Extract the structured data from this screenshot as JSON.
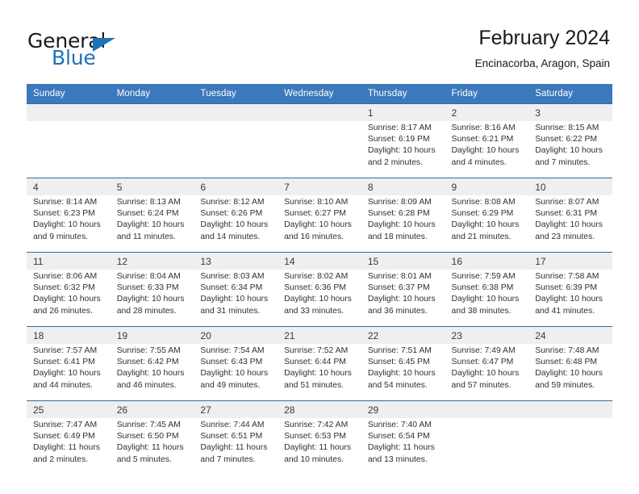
{
  "brand": {
    "name_part1": "General",
    "name_part2": "Blue",
    "accent_color": "#1F72B8"
  },
  "header": {
    "title": "February 2024",
    "subtitle": "Encinacorba, Aragon, Spain"
  },
  "colors": {
    "header_row_bg": "#3B79BC",
    "daynum_bg": "#EFEFEF",
    "separator": "#2B6CAD",
    "text": "#303030"
  },
  "weekday_headers": [
    "Sunday",
    "Monday",
    "Tuesday",
    "Wednesday",
    "Thursday",
    "Friday",
    "Saturday"
  ],
  "weeks": [
    {
      "days": [
        {
          "date": "",
          "blank": true,
          "sunrise": "",
          "sunset": "",
          "daylight_line1": "",
          "daylight_line2": ""
        },
        {
          "date": "",
          "blank": true,
          "sunrise": "",
          "sunset": "",
          "daylight_line1": "",
          "daylight_line2": ""
        },
        {
          "date": "",
          "blank": true,
          "sunrise": "",
          "sunset": "",
          "daylight_line1": "",
          "daylight_line2": ""
        },
        {
          "date": "",
          "blank": true,
          "sunrise": "",
          "sunset": "",
          "daylight_line1": "",
          "daylight_line2": ""
        },
        {
          "date": "1",
          "blank": false,
          "sunrise": "Sunrise: 8:17 AM",
          "sunset": "Sunset: 6:19 PM",
          "daylight_line1": "Daylight: 10 hours",
          "daylight_line2": "and 2 minutes."
        },
        {
          "date": "2",
          "blank": false,
          "sunrise": "Sunrise: 8:16 AM",
          "sunset": "Sunset: 6:21 PM",
          "daylight_line1": "Daylight: 10 hours",
          "daylight_line2": "and 4 minutes."
        },
        {
          "date": "3",
          "blank": false,
          "sunrise": "Sunrise: 8:15 AM",
          "sunset": "Sunset: 6:22 PM",
          "daylight_line1": "Daylight: 10 hours",
          "daylight_line2": "and 7 minutes."
        }
      ]
    },
    {
      "days": [
        {
          "date": "4",
          "blank": false,
          "sunrise": "Sunrise: 8:14 AM",
          "sunset": "Sunset: 6:23 PM",
          "daylight_line1": "Daylight: 10 hours",
          "daylight_line2": "and 9 minutes."
        },
        {
          "date": "5",
          "blank": false,
          "sunrise": "Sunrise: 8:13 AM",
          "sunset": "Sunset: 6:24 PM",
          "daylight_line1": "Daylight: 10 hours",
          "daylight_line2": "and 11 minutes."
        },
        {
          "date": "6",
          "blank": false,
          "sunrise": "Sunrise: 8:12 AM",
          "sunset": "Sunset: 6:26 PM",
          "daylight_line1": "Daylight: 10 hours",
          "daylight_line2": "and 14 minutes."
        },
        {
          "date": "7",
          "blank": false,
          "sunrise": "Sunrise: 8:10 AM",
          "sunset": "Sunset: 6:27 PM",
          "daylight_line1": "Daylight: 10 hours",
          "daylight_line2": "and 16 minutes."
        },
        {
          "date": "8",
          "blank": false,
          "sunrise": "Sunrise: 8:09 AM",
          "sunset": "Sunset: 6:28 PM",
          "daylight_line1": "Daylight: 10 hours",
          "daylight_line2": "and 18 minutes."
        },
        {
          "date": "9",
          "blank": false,
          "sunrise": "Sunrise: 8:08 AM",
          "sunset": "Sunset: 6:29 PM",
          "daylight_line1": "Daylight: 10 hours",
          "daylight_line2": "and 21 minutes."
        },
        {
          "date": "10",
          "blank": false,
          "sunrise": "Sunrise: 8:07 AM",
          "sunset": "Sunset: 6:31 PM",
          "daylight_line1": "Daylight: 10 hours",
          "daylight_line2": "and 23 minutes."
        }
      ]
    },
    {
      "days": [
        {
          "date": "11",
          "blank": false,
          "sunrise": "Sunrise: 8:06 AM",
          "sunset": "Sunset: 6:32 PM",
          "daylight_line1": "Daylight: 10 hours",
          "daylight_line2": "and 26 minutes."
        },
        {
          "date": "12",
          "blank": false,
          "sunrise": "Sunrise: 8:04 AM",
          "sunset": "Sunset: 6:33 PM",
          "daylight_line1": "Daylight: 10 hours",
          "daylight_line2": "and 28 minutes."
        },
        {
          "date": "13",
          "blank": false,
          "sunrise": "Sunrise: 8:03 AM",
          "sunset": "Sunset: 6:34 PM",
          "daylight_line1": "Daylight: 10 hours",
          "daylight_line2": "and 31 minutes."
        },
        {
          "date": "14",
          "blank": false,
          "sunrise": "Sunrise: 8:02 AM",
          "sunset": "Sunset: 6:36 PM",
          "daylight_line1": "Daylight: 10 hours",
          "daylight_line2": "and 33 minutes."
        },
        {
          "date": "15",
          "blank": false,
          "sunrise": "Sunrise: 8:01 AM",
          "sunset": "Sunset: 6:37 PM",
          "daylight_line1": "Daylight: 10 hours",
          "daylight_line2": "and 36 minutes."
        },
        {
          "date": "16",
          "blank": false,
          "sunrise": "Sunrise: 7:59 AM",
          "sunset": "Sunset: 6:38 PM",
          "daylight_line1": "Daylight: 10 hours",
          "daylight_line2": "and 38 minutes."
        },
        {
          "date": "17",
          "blank": false,
          "sunrise": "Sunrise: 7:58 AM",
          "sunset": "Sunset: 6:39 PM",
          "daylight_line1": "Daylight: 10 hours",
          "daylight_line2": "and 41 minutes."
        }
      ]
    },
    {
      "days": [
        {
          "date": "18",
          "blank": false,
          "sunrise": "Sunrise: 7:57 AM",
          "sunset": "Sunset: 6:41 PM",
          "daylight_line1": "Daylight: 10 hours",
          "daylight_line2": "and 44 minutes."
        },
        {
          "date": "19",
          "blank": false,
          "sunrise": "Sunrise: 7:55 AM",
          "sunset": "Sunset: 6:42 PM",
          "daylight_line1": "Daylight: 10 hours",
          "daylight_line2": "and 46 minutes."
        },
        {
          "date": "20",
          "blank": false,
          "sunrise": "Sunrise: 7:54 AM",
          "sunset": "Sunset: 6:43 PM",
          "daylight_line1": "Daylight: 10 hours",
          "daylight_line2": "and 49 minutes."
        },
        {
          "date": "21",
          "blank": false,
          "sunrise": "Sunrise: 7:52 AM",
          "sunset": "Sunset: 6:44 PM",
          "daylight_line1": "Daylight: 10 hours",
          "daylight_line2": "and 51 minutes."
        },
        {
          "date": "22",
          "blank": false,
          "sunrise": "Sunrise: 7:51 AM",
          "sunset": "Sunset: 6:45 PM",
          "daylight_line1": "Daylight: 10 hours",
          "daylight_line2": "and 54 minutes."
        },
        {
          "date": "23",
          "blank": false,
          "sunrise": "Sunrise: 7:49 AM",
          "sunset": "Sunset: 6:47 PM",
          "daylight_line1": "Daylight: 10 hours",
          "daylight_line2": "and 57 minutes."
        },
        {
          "date": "24",
          "blank": false,
          "sunrise": "Sunrise: 7:48 AM",
          "sunset": "Sunset: 6:48 PM",
          "daylight_line1": "Daylight: 10 hours",
          "daylight_line2": "and 59 minutes."
        }
      ]
    },
    {
      "days": [
        {
          "date": "25",
          "blank": false,
          "sunrise": "Sunrise: 7:47 AM",
          "sunset": "Sunset: 6:49 PM",
          "daylight_line1": "Daylight: 11 hours",
          "daylight_line2": "and 2 minutes."
        },
        {
          "date": "26",
          "blank": false,
          "sunrise": "Sunrise: 7:45 AM",
          "sunset": "Sunset: 6:50 PM",
          "daylight_line1": "Daylight: 11 hours",
          "daylight_line2": "and 5 minutes."
        },
        {
          "date": "27",
          "blank": false,
          "sunrise": "Sunrise: 7:44 AM",
          "sunset": "Sunset: 6:51 PM",
          "daylight_line1": "Daylight: 11 hours",
          "daylight_line2": "and 7 minutes."
        },
        {
          "date": "28",
          "blank": false,
          "sunrise": "Sunrise: 7:42 AM",
          "sunset": "Sunset: 6:53 PM",
          "daylight_line1": "Daylight: 11 hours",
          "daylight_line2": "and 10 minutes."
        },
        {
          "date": "29",
          "blank": false,
          "sunrise": "Sunrise: 7:40 AM",
          "sunset": "Sunset: 6:54 PM",
          "daylight_line1": "Daylight: 11 hours",
          "daylight_line2": "and 13 minutes."
        },
        {
          "date": "",
          "blank": true,
          "sunrise": "",
          "sunset": "",
          "daylight_line1": "",
          "daylight_line2": ""
        },
        {
          "date": "",
          "blank": true,
          "sunrise": "",
          "sunset": "",
          "daylight_line1": "",
          "daylight_line2": ""
        }
      ]
    }
  ]
}
